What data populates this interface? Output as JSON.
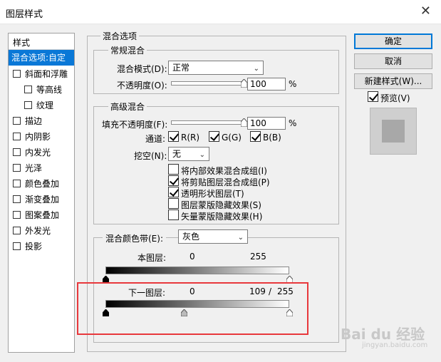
{
  "window": {
    "title": "图层样式",
    "close_glyph": "✕"
  },
  "sidebar": {
    "header": "样式",
    "items": [
      {
        "label": "混合选项:自定",
        "selected": true,
        "checkbox": false,
        "indent": 0
      },
      {
        "label": "斜面和浮雕",
        "checked": false,
        "indent": 0
      },
      {
        "label": "等高线",
        "checked": false,
        "indent": 1
      },
      {
        "label": "纹理",
        "checked": false,
        "indent": 1
      },
      {
        "label": "描边",
        "checked": false,
        "indent": 0
      },
      {
        "label": "内阴影",
        "checked": false,
        "indent": 0
      },
      {
        "label": "内发光",
        "checked": false,
        "indent": 0
      },
      {
        "label": "光泽",
        "checked": false,
        "indent": 0
      },
      {
        "label": "颜色叠加",
        "checked": false,
        "indent": 0
      },
      {
        "label": "渐变叠加",
        "checked": false,
        "indent": 0
      },
      {
        "label": "图案叠加",
        "checked": false,
        "indent": 0
      },
      {
        "label": "外发光",
        "checked": false,
        "indent": 0
      },
      {
        "label": "投影",
        "checked": false,
        "indent": 0
      }
    ]
  },
  "blend_options": {
    "title": "混合选项",
    "general": {
      "title": "常规混合",
      "mode_label": "混合模式(D):",
      "mode_value": "正常",
      "opacity_label": "不透明度(O):",
      "opacity_value": "100",
      "opacity_unit": "%",
      "opacity_level": 1.0
    },
    "advanced": {
      "title": "高级混合",
      "fill_label": "填充不透明度(F):",
      "fill_value": "100",
      "fill_unit": "%",
      "fill_level": 1.0,
      "channels_label": "通道:",
      "channels": [
        {
          "label": "R(R)",
          "checked": true
        },
        {
          "label": "G(G)",
          "checked": true
        },
        {
          "label": "B(B)",
          "checked": true
        }
      ],
      "knockout_label": "挖空(N):",
      "knockout_value": "无",
      "options": [
        {
          "label": "将内部效果混合成组(I)",
          "checked": false
        },
        {
          "label": "将剪贴图层混合成组(P)",
          "checked": true
        },
        {
          "label": "透明形状图层(T)",
          "checked": true
        },
        {
          "label": "图层蒙版隐藏效果(S)",
          "checked": false
        },
        {
          "label": "矢量蒙版隐藏效果(H)",
          "checked": false
        }
      ]
    },
    "blend_if": {
      "label": "混合颜色带(E):",
      "value": "灰色",
      "this_layer": {
        "label": "本图层:",
        "min": "0",
        "max": "255",
        "min_level": 0,
        "max_level": 255
      },
      "underlying": {
        "label": "下一图层:",
        "min": "0",
        "split": "109",
        "sep": "/",
        "max": "255",
        "min_level": 0,
        "split_level": 109,
        "max_level": 255
      }
    }
  },
  "buttons": {
    "ok": "确定",
    "cancel": "取消",
    "new_style": "新建样式(W)...",
    "preview_label": "预览(V)",
    "preview_checked": true
  },
  "watermark": {
    "text": "Bai du 经验",
    "sub": "jingyan.baidu.com"
  },
  "colors": {
    "selection": "#0a78d7",
    "highlight": "#e8383c",
    "primary_border": "#0078d7"
  }
}
